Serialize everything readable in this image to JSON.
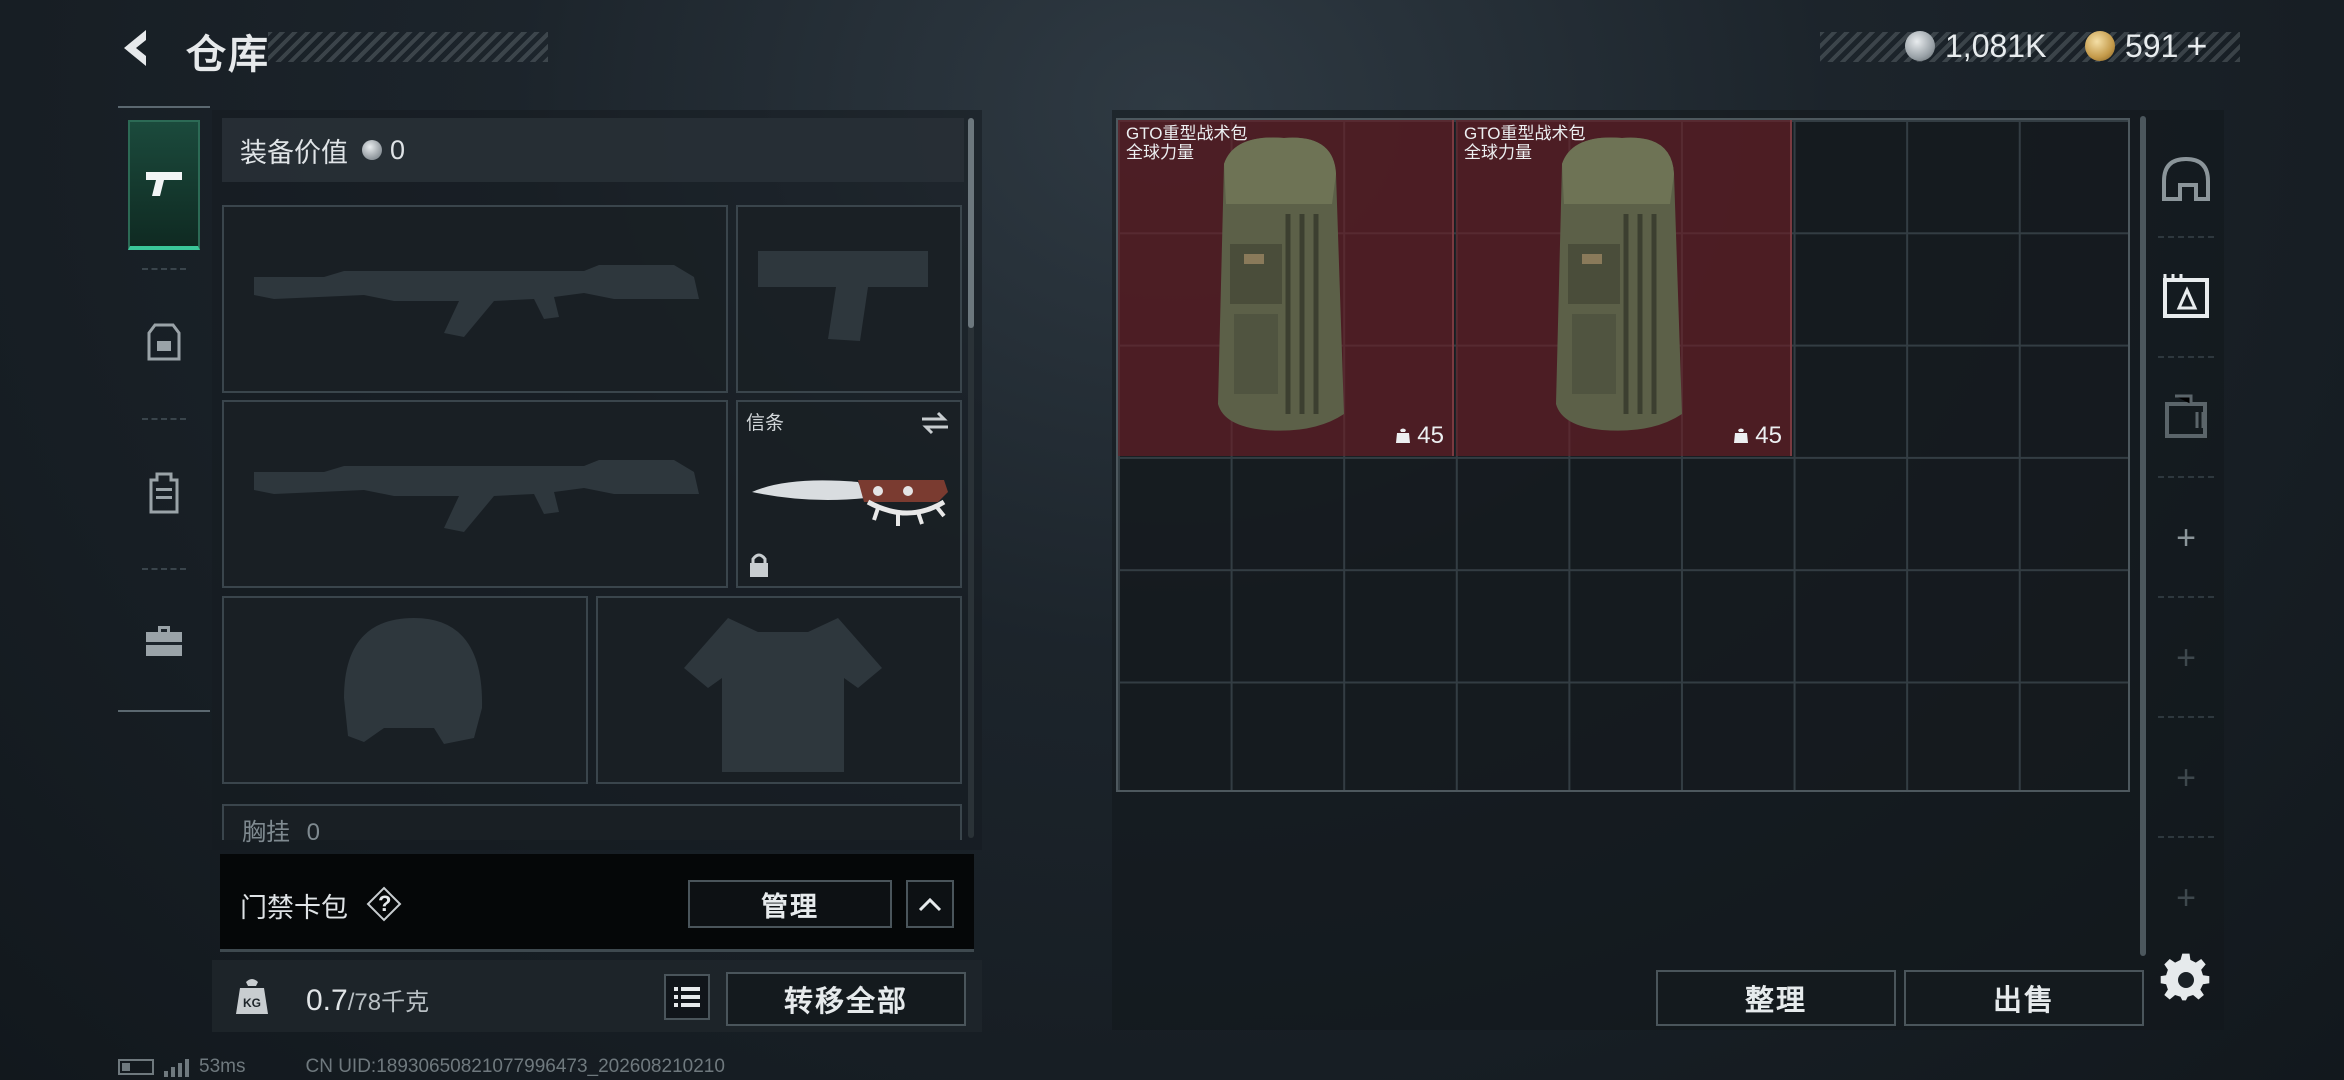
{
  "header": {
    "title": "仓库",
    "back_icon": "back-arrow-icon",
    "currency_silver": "1,081K",
    "currency_gold": "591",
    "currency_add": "+"
  },
  "left_tabs": [
    {
      "icon": "pistol-icon",
      "active": true
    },
    {
      "icon": "armor-rig-icon",
      "active": false
    },
    {
      "icon": "backpack-icon",
      "active": false
    },
    {
      "icon": "briefcase-icon",
      "active": false
    }
  ],
  "equipment": {
    "value_label": "装备价值",
    "value_amount": "0",
    "melee_label": "信条",
    "partial_label": "胸挂",
    "partial_value": "0"
  },
  "access_card": {
    "label": "门禁卡包",
    "help": "?",
    "manage_label": "管理"
  },
  "weight": {
    "current": "0.7",
    "max": "/78千克",
    "icon_text": "KG",
    "transfer_label": "转移全部"
  },
  "storage": {
    "items": [
      {
        "name_line1": "GTO重型战术包",
        "name_line2": "全球力量",
        "count": "45"
      },
      {
        "name_line1": "GTO重型战术包",
        "name_line2": "全球力量",
        "count": "45"
      }
    ],
    "sort_label": "整理",
    "sell_label": "出售"
  },
  "right_tabs": [
    {
      "icon": "helmet-tab-icon"
    },
    {
      "icon": "stash-tab-icon"
    },
    {
      "icon": "case-tab-icon"
    },
    {
      "icon": "plus-icon"
    },
    {
      "icon": "plus-icon"
    },
    {
      "icon": "plus-icon"
    },
    {
      "icon": "plus-icon"
    }
  ],
  "footer": {
    "ping": "53ms",
    "uid": "CN UID:18930650821077996473_202608210210"
  },
  "colors": {
    "accent_green": "#3bc79a",
    "item_red": "#6e1e26"
  }
}
